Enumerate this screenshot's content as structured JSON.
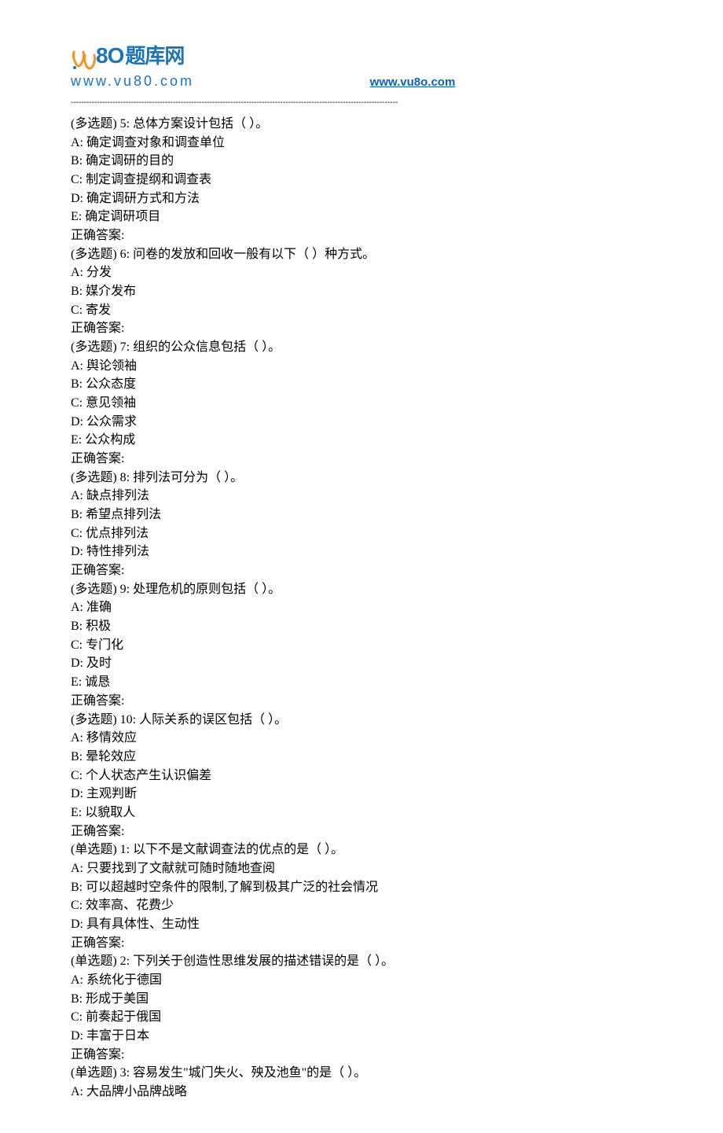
{
  "header": {
    "logo_chars": "题库网",
    "logo_url_text": "www.vu80.com",
    "link_text": "www.vu8o.com"
  },
  "questions": [
    {
      "prefix": "(多选题) 5: ",
      "text": "总体方案设计包括（ ）。",
      "options": [
        "A: 确定调查对象和调查单位",
        "B: 确定调研的目的",
        "C: 制定调查提纲和调查表",
        "D: 确定调研方式和方法",
        "E: 确定调研项目"
      ],
      "answer_label": "正确答案:"
    },
    {
      "prefix": "(多选题) 6: ",
      "text": "问卷的发放和回收一般有以下（ ）种方式。",
      "options": [
        "A: 分发",
        "B: 媒介发布",
        "C: 寄发"
      ],
      "answer_label": "正确答案:"
    },
    {
      "prefix": "(多选题) 7: ",
      "text": "组织的公众信息包括（ ）。",
      "options": [
        "A: 舆论领袖",
        "B: 公众态度",
        "C: 意见领袖",
        "D: 公众需求",
        "E: 公众构成"
      ],
      "answer_label": "正确答案:"
    },
    {
      "prefix": "(多选题) 8: ",
      "text": "排列法可分为（ ）。",
      "options": [
        "A: 缺点排列法",
        "B: 希望点排列法",
        "C: 优点排列法",
        "D: 特性排列法"
      ],
      "answer_label": "正确答案:"
    },
    {
      "prefix": "(多选题) 9: ",
      "text": "处理危机的原则包括（ ）。",
      "options": [
        "A: 准确",
        "B: 积极",
        "C: 专门化",
        "D: 及时",
        "E: 诚恳"
      ],
      "answer_label": "正确答案:"
    },
    {
      "prefix": "(多选题) 10: ",
      "text": "人际关系的误区包括（ ）。",
      "options": [
        "A: 移情效应",
        "B: 晕轮效应",
        "C: 个人状态产生认识偏差",
        "D: 主观判断",
        "E: 以貌取人"
      ],
      "answer_label": "正确答案:"
    },
    {
      "prefix": "(单选题) 1: ",
      "text": "以下不是文献调查法的优点的是（ ）。",
      "options": [
        "A: 只要找到了文献就可随时随地查阅",
        "B: 可以超越时空条件的限制,了解到极其广泛的社会情况",
        "C: 效率高、花费少",
        "D: 具有具体性、生动性"
      ],
      "answer_label": "正确答案:"
    },
    {
      "prefix": "(单选题) 2: ",
      "text": "下列关于创造性思维发展的描述错误的是（ ）。",
      "options": [
        "A: 系统化于德国",
        "B: 形成于美国",
        "C: 前奏起于俄国",
        "D: 丰富于日本"
      ],
      "answer_label": "正确答案:"
    },
    {
      "prefix": "(单选题) 3: ",
      "text": "容易发生\"城门失火、殃及池鱼\"的是（ ）。",
      "options": [
        "A: 大品牌小品牌战略"
      ],
      "answer_label": ""
    }
  ]
}
